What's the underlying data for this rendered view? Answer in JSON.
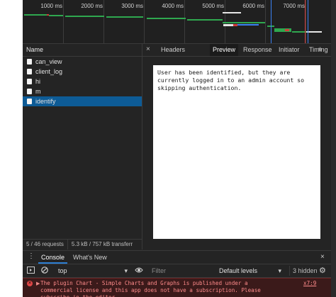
{
  "timeline": {
    "ticks": [
      "1000 ms",
      "2000 ms",
      "3000 ms",
      "4000 ms",
      "5000 ms",
      "6000 ms",
      "7000 ms"
    ]
  },
  "network": {
    "name_header": "Name",
    "requests": [
      "can_view",
      "client_log",
      "hi",
      "m",
      "identify"
    ],
    "selected": "identify",
    "summary_requests": "5 / 46 requests",
    "summary_transfer": "5.3 kB / 757 kB transferr"
  },
  "details": {
    "close": "×",
    "tabs": [
      "Headers",
      "Preview",
      "Response",
      "Initiator",
      "Timing"
    ],
    "active_tab": "Preview",
    "more": "»",
    "preview_text": "User has been identified, but they are currently logged in to an admin account so skipping authentication."
  },
  "drawer": {
    "menu": "⋮",
    "tabs": [
      "Console",
      "What's New"
    ],
    "close": "×"
  },
  "console": {
    "context": "top",
    "filter_placeholder": "Filter",
    "levels": "Default levels",
    "hidden": "3 hidden",
    "error_text": "The plugin Chart - Simple Charts and Graphs is published under a commercial license and this app does not have a subscription. Please subscribe in the editor.",
    "error_source": "x7:9"
  },
  "colors": {
    "accent": "#0d5b96",
    "error_bg": "#3b1a1a",
    "error_text": "#ff8b8b"
  }
}
